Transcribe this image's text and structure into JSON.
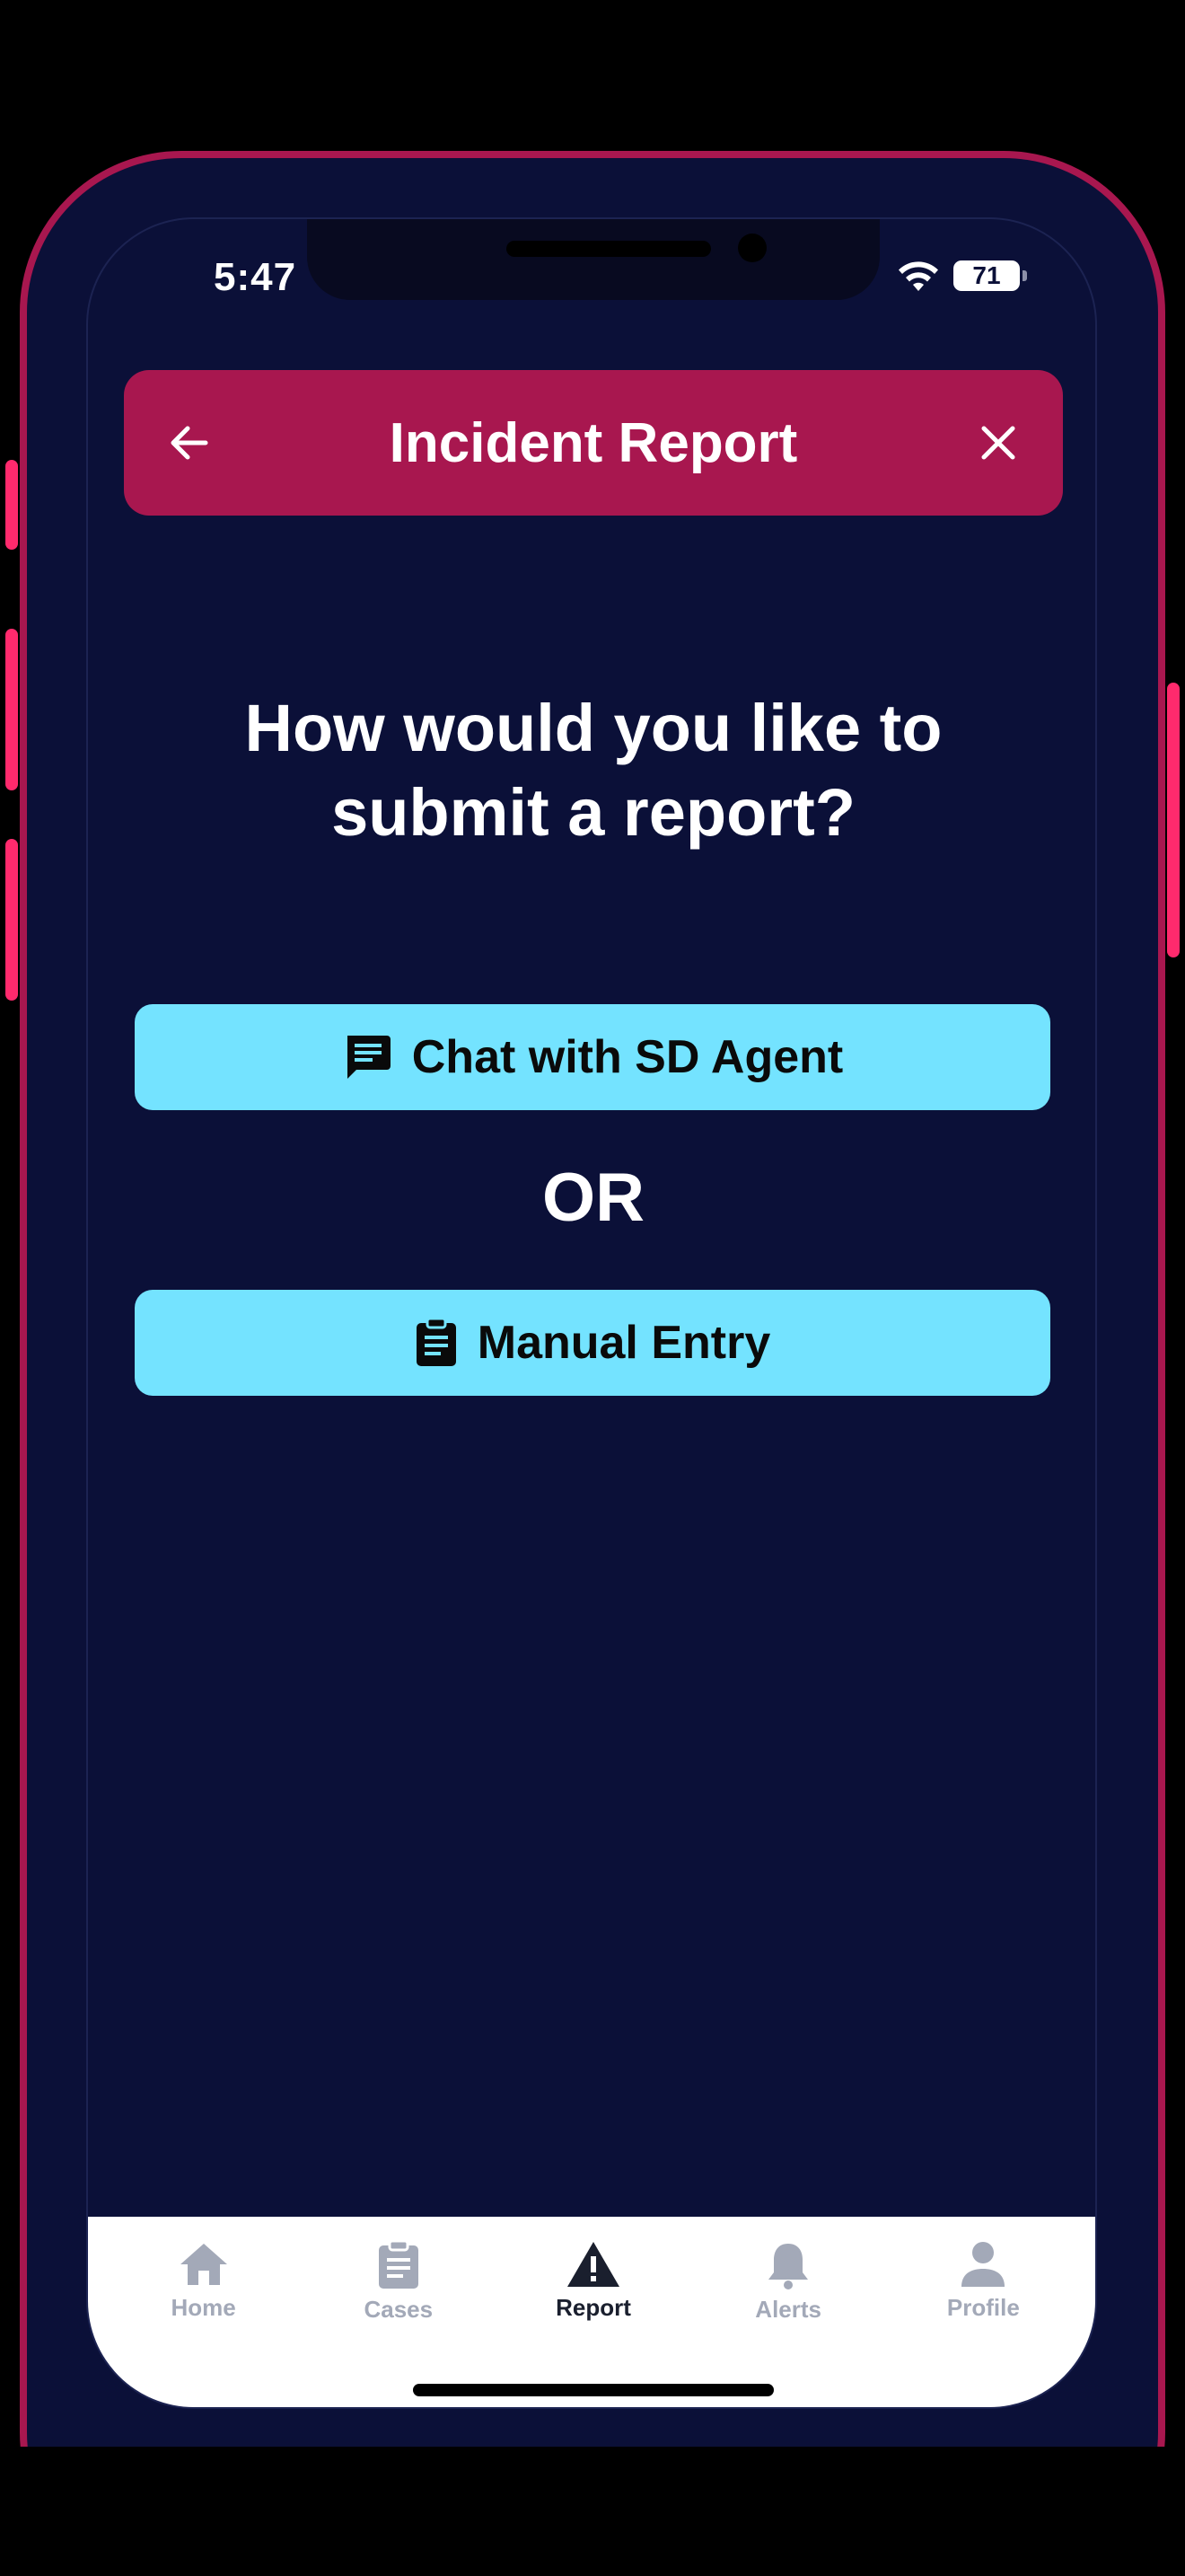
{
  "status_bar": {
    "time": "5:47",
    "battery": "71"
  },
  "header": {
    "title": "Incident Report",
    "back_icon": "arrow-left-icon",
    "close_icon": "close-icon"
  },
  "prompt": {
    "line1": "How would you like to",
    "line2": "submit a report?"
  },
  "options": {
    "chat_label": "Chat with SD Agent",
    "or_label": "OR",
    "manual_label": "Manual Entry"
  },
  "tabs": [
    {
      "label": "Home",
      "icon": "home-icon",
      "active": false
    },
    {
      "label": "Cases",
      "icon": "clipboard-icon",
      "active": false
    },
    {
      "label": "Report",
      "icon": "warning-icon",
      "active": true
    },
    {
      "label": "Alerts",
      "icon": "bell-icon",
      "active": false
    },
    {
      "label": "Profile",
      "icon": "person-icon",
      "active": false
    }
  ],
  "colors": {
    "background": "#0b1038",
    "header": "#a8174f",
    "accent_button": "#74e3ff",
    "frame_button": "#ff2a6d",
    "tab_inactive": "#a3a9b8",
    "tab_active": "#1a1f2e"
  }
}
